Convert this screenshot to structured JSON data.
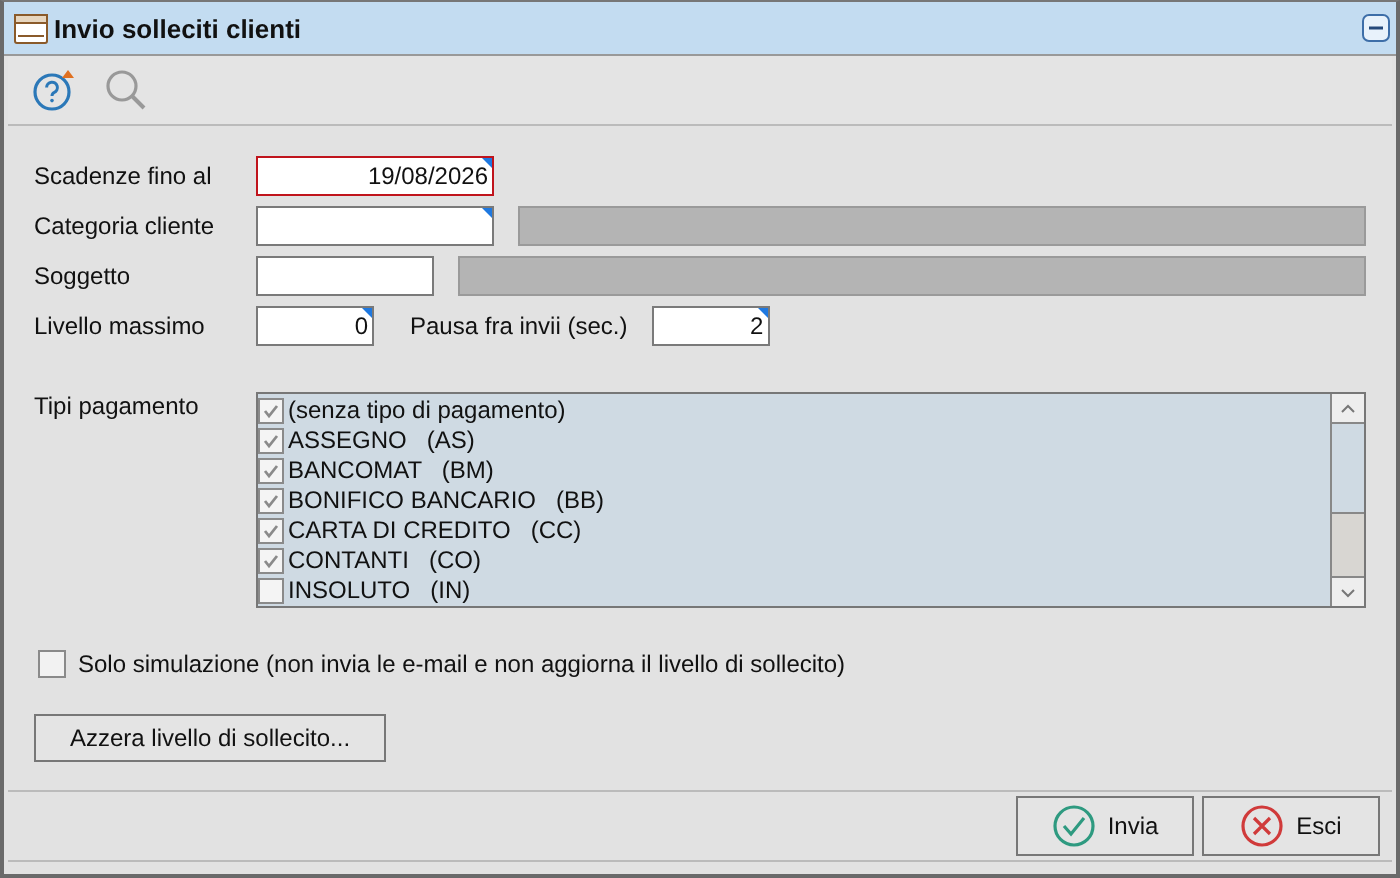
{
  "window": {
    "title": "Invio solleciti clienti"
  },
  "rows": [
    [
      {
        "label": "Scadenze fino al",
        "value": "19/08/2026",
        "kind": "date",
        "error": true
      }
    ],
    [
      {
        "label": "Categoria cliente",
        "kind": "lookup",
        "error": false
      }
    ],
    [
      {
        "label": "Soggetto",
        "kind": "code",
        "error": false
      }
    ],
    [
      {
        "label": "Livello massimo",
        "value": "0",
        "kind": "number",
        "error": false
      },
      {
        "label": "Pausa fra invii (sec.)",
        "value": "2",
        "kind": "number",
        "error": false
      }
    ]
  ],
  "payment_types": {
    "label": "Tipi pagamento",
    "items": [
      {
        "label": "(senza tipo di pagamento)",
        "checked": true
      },
      {
        "label": "ASSEGNO   (AS)",
        "checked": true
      },
      {
        "label": "BANCOMAT   (BM)",
        "checked": true
      },
      {
        "label": "BONIFICO BANCARIO   (BB)",
        "checked": true
      },
      {
        "label": "CARTA DI CREDITO   (CC)",
        "checked": true
      },
      {
        "label": "CONTANTI   (CO)",
        "checked": true
      },
      {
        "label": "INSOLUTO   (IN)",
        "checked": false
      }
    ]
  },
  "simulation": {
    "label": "Solo simulazione (non invia le e-mail e non aggiorna il livello di sollecito)",
    "checked": false
  },
  "reset_button": "Azzera livello di sollecito...",
  "footer_buttons": [
    {
      "label": "Invia",
      "kind": "ok"
    },
    {
      "label": "Esci",
      "kind": "cancel"
    }
  ]
}
